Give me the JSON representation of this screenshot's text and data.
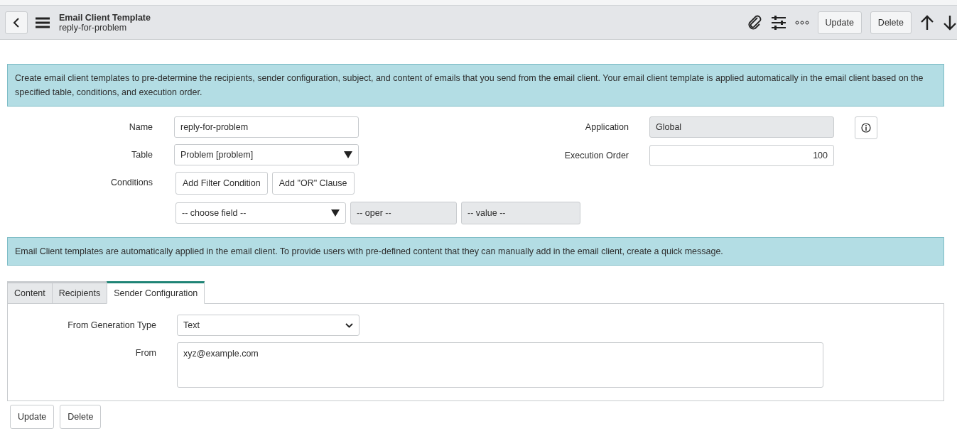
{
  "header": {
    "title": "Email Client Template",
    "subtitle": "reply-for-problem",
    "buttons": [
      "Update",
      "Delete"
    ]
  },
  "info_top": "Create email client templates to pre-determine the recipients, sender configuration, subject, and content of emails that you send from the email client. Your email client template is applied automatically in the email client based on the specified table, conditions, and execution order.",
  "fields": {
    "name": {
      "label": "Name",
      "value": "reply-for-problem"
    },
    "table": {
      "label": "Table",
      "value": "Problem [problem]"
    },
    "application": {
      "label": "Application",
      "value": "Global"
    },
    "execution_order": {
      "label": "Execution Order",
      "value": "100"
    }
  },
  "conditions": {
    "label": "Conditions",
    "buttons": [
      "Add Filter Condition",
      "Add \"OR\" Clause"
    ],
    "field": "-- choose field --",
    "oper": "-- oper --",
    "value": "-- value --"
  },
  "info_bottom": "Email Client templates are automatically applied in the email client. To provide users with pre-defined content that they can manually add in the email client, create a quick message.",
  "tabs": [
    {
      "label": "Content",
      "selected": false
    },
    {
      "label": "Recipients",
      "selected": false
    },
    {
      "label": "Sender Configuration",
      "selected": true
    }
  ],
  "sender": {
    "type_label": "From Generation Type",
    "type_value": "Text",
    "from_label": "From",
    "from_value": "xyz@example.com"
  },
  "bottom_buttons": [
    "Update",
    "Delete"
  ]
}
